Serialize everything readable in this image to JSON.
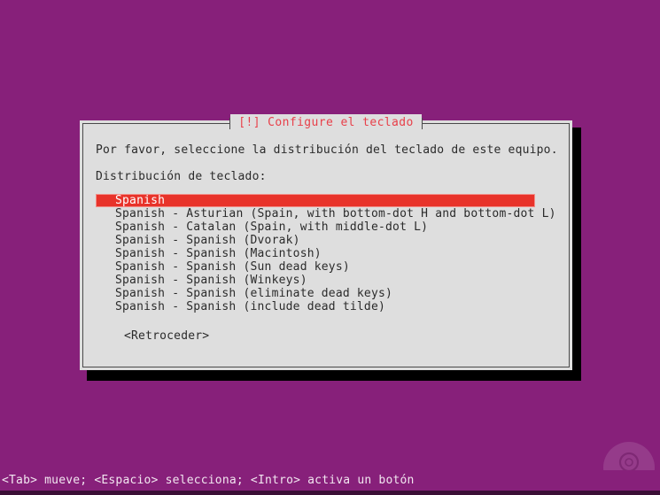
{
  "screen": {
    "background_color": "#87207a",
    "logo": "ubuntu-circle-logo"
  },
  "dialog": {
    "title": "[!] Configure el teclado",
    "title_color": "#e8404a",
    "background_color": "#dedede",
    "intro_text": "Por favor, seleccione la distribución del teclado de este equipo.",
    "field_label": "Distribución de teclado:",
    "options": [
      {
        "label": "Spanish",
        "selected": true
      },
      {
        "label": "Spanish - Asturian (Spain, with bottom-dot H and bottom-dot L)",
        "selected": false
      },
      {
        "label": "Spanish - Catalan (Spain, with middle-dot L)",
        "selected": false
      },
      {
        "label": "Spanish - Spanish (Dvorak)",
        "selected": false
      },
      {
        "label": "Spanish - Spanish (Macintosh)",
        "selected": false
      },
      {
        "label": "Spanish - Spanish (Sun dead keys)",
        "selected": false
      },
      {
        "label": "Spanish - Spanish (Winkeys)",
        "selected": false
      },
      {
        "label": "Spanish - Spanish (eliminate dead keys)",
        "selected": false
      },
      {
        "label": "Spanish - Spanish (include dead tilde)",
        "selected": false
      }
    ],
    "selection_highlight_color": "#e8332a",
    "back_button": "<Retroceder>"
  },
  "status_bar": {
    "text": "<Tab> mueve; <Espacio> selecciona; <Intro> activa un botón"
  }
}
